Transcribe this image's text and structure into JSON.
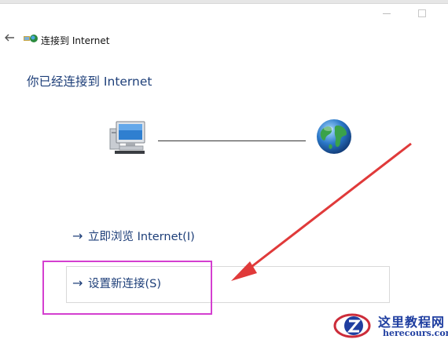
{
  "window": {
    "title": "连接到 Internet"
  },
  "heading": "你已经连接到 Internet",
  "actions": {
    "browse_label": "立即浏览 Internet(I)",
    "new_connection_label": "设置新连接(S)"
  },
  "icons": {
    "back": "back-arrow-icon",
    "title": "network-connection-icon",
    "computer": "computer-icon",
    "internet": "globe-icon",
    "link_arrow": "arrow-right-icon"
  },
  "annotation": {
    "highlight_color": "#d43fd0",
    "arrow_color": "#e03a3a"
  },
  "watermark": {
    "name": "这里教程网",
    "url": "herecours.com"
  },
  "colors": {
    "link": "#1e3f79",
    "heading": "#1e3f79"
  }
}
